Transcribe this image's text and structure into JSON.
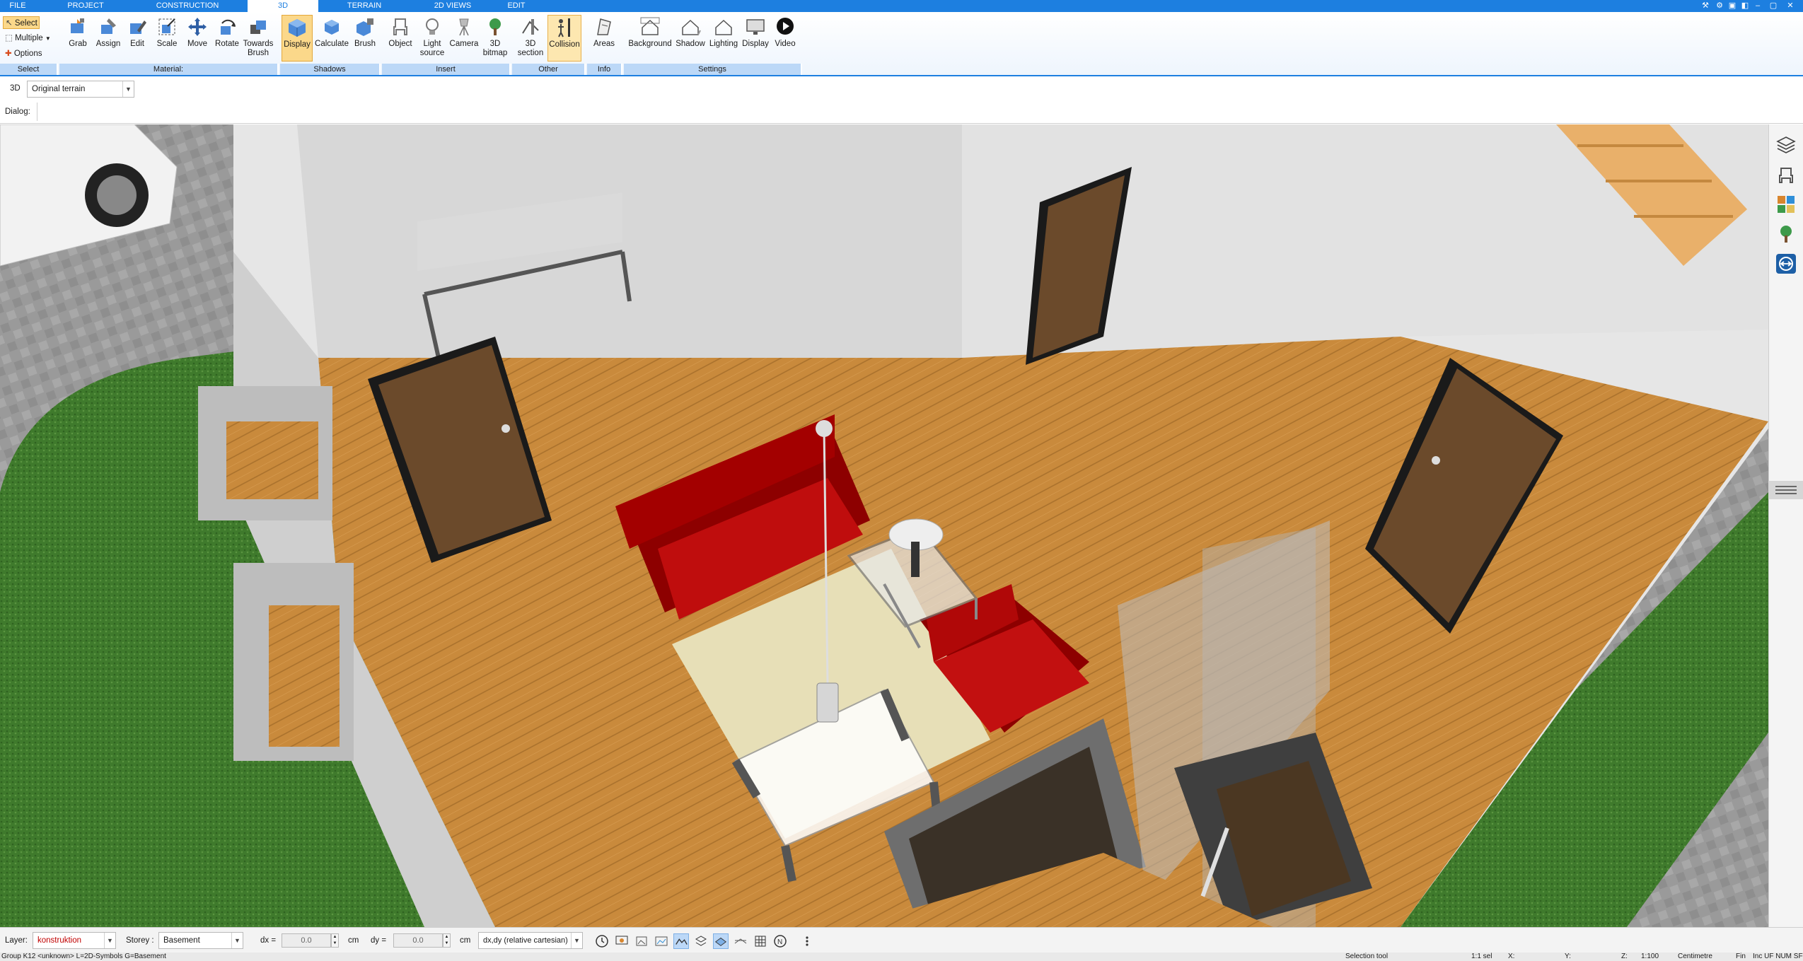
{
  "menu": {
    "tabs": [
      "FILE",
      "PROJECT",
      "CONSTRUCTION",
      "3D",
      "TERRAIN",
      "2D VIEWS",
      "EDIT"
    ],
    "active": "3D"
  },
  "ribbon": {
    "select_group": {
      "select": "Select",
      "multiple": "Multiple",
      "options": "Options",
      "label": "Select"
    },
    "material_group": {
      "label": "Material:",
      "buttons": [
        "Grab",
        "Assign",
        "Edit",
        "Scale",
        "Move",
        "Rotate",
        "Towards Brush"
      ]
    },
    "shadows_group": {
      "label": "Shadows",
      "buttons": [
        "Display",
        "Calculate",
        "Brush"
      ]
    },
    "insert_group": {
      "label": "Insert",
      "buttons": [
        "Object",
        "Light source",
        "Camera",
        "3D bitmap"
      ]
    },
    "other_group": {
      "label": "Other",
      "buttons": [
        "3D section",
        "Collision"
      ]
    },
    "info_group": {
      "label": "Info",
      "buttons": [
        "Areas"
      ]
    },
    "settings_group": {
      "label": "Settings",
      "buttons": [
        "Background",
        "Shadow",
        "Lighting",
        "Display",
        "Video"
      ]
    }
  },
  "viewbar": {
    "mode_label": "3D",
    "terrain_value": "Original terrain"
  },
  "dialogbar": {
    "label": "Dialog:"
  },
  "layerbar": {
    "layer_label": "Layer:",
    "layer_value": "konstruktion",
    "storey_label": "Storey :",
    "storey_value": "Basement",
    "dx_label": "dx =",
    "dx_value": "0.0",
    "dx_unit": "cm",
    "dy_label": "dy =",
    "dy_value": "0.0",
    "dy_unit": "cm",
    "coord_mode": "dx,dy (relative cartesian)"
  },
  "statusbar": {
    "left": "Group K12 <unknown> L=2D-Symbols G=Basement",
    "tool": "Selection tool",
    "sel": "1:1 sel",
    "x": "X:",
    "y": "Y:",
    "z": "Z:",
    "scale": "1:100",
    "unit": "Centimetre",
    "fin": "Fin",
    "flags": "Inc  UF  NUM  SF"
  },
  "colors": {
    "accent": "#1d7fe0",
    "ribbon_group": "#bcd8f7",
    "active_button": "#fbd88a",
    "layer_red": "#c00000"
  }
}
